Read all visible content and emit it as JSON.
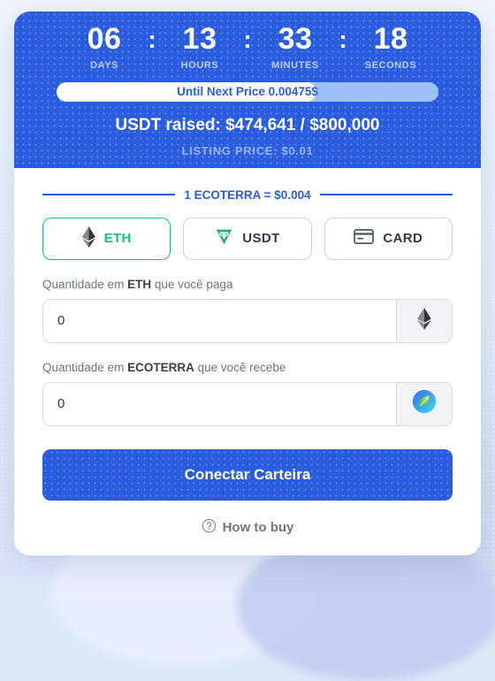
{
  "countdown": {
    "units": [
      {
        "value": "06",
        "label": "DAYS"
      },
      {
        "value": "13",
        "label": "HOURS"
      },
      {
        "value": "33",
        "label": "MINUTES"
      },
      {
        "value": "18",
        "label": "SECONDS"
      }
    ],
    "separator": ":"
  },
  "progress": {
    "text": "Until Next Price 0.00475$",
    "percent": 68
  },
  "raised": {
    "text": "USDT raised: $474,641 / $800,000",
    "current": "$474,641",
    "goal": "$800,000"
  },
  "listing_price": "LISTING PRICE: $0.01",
  "rate": {
    "text": "1 ECOTERRA = $0.004"
  },
  "payment_tabs": [
    {
      "label": "ETH",
      "icon": "ethereum-icon",
      "active": true
    },
    {
      "label": "USDT",
      "icon": "tether-icon",
      "active": false
    },
    {
      "label": "CARD",
      "icon": "credit-card-icon",
      "active": false
    }
  ],
  "pay_field": {
    "label_prefix": "Quantidade em ",
    "label_strong": "ETH",
    "label_suffix": " que você paga",
    "value": "0",
    "placeholder": "0",
    "icon": "ethereum-icon"
  },
  "receive_field": {
    "label_prefix": "Quantidade em ",
    "label_strong": "ECOTERRA",
    "label_suffix": " que você recebe",
    "value": "0",
    "placeholder": "0",
    "icon": "ecoterra-leaf-icon"
  },
  "cta": {
    "label": "Conectar Carteira"
  },
  "howto": {
    "label": "How to buy",
    "icon": "question-circle-icon"
  },
  "colors": {
    "brand_blue": "#2a5ce0",
    "accent_green": "#19bf7c",
    "progress_track": "#9dc0fb",
    "muted_blue": "#96b5f2"
  }
}
